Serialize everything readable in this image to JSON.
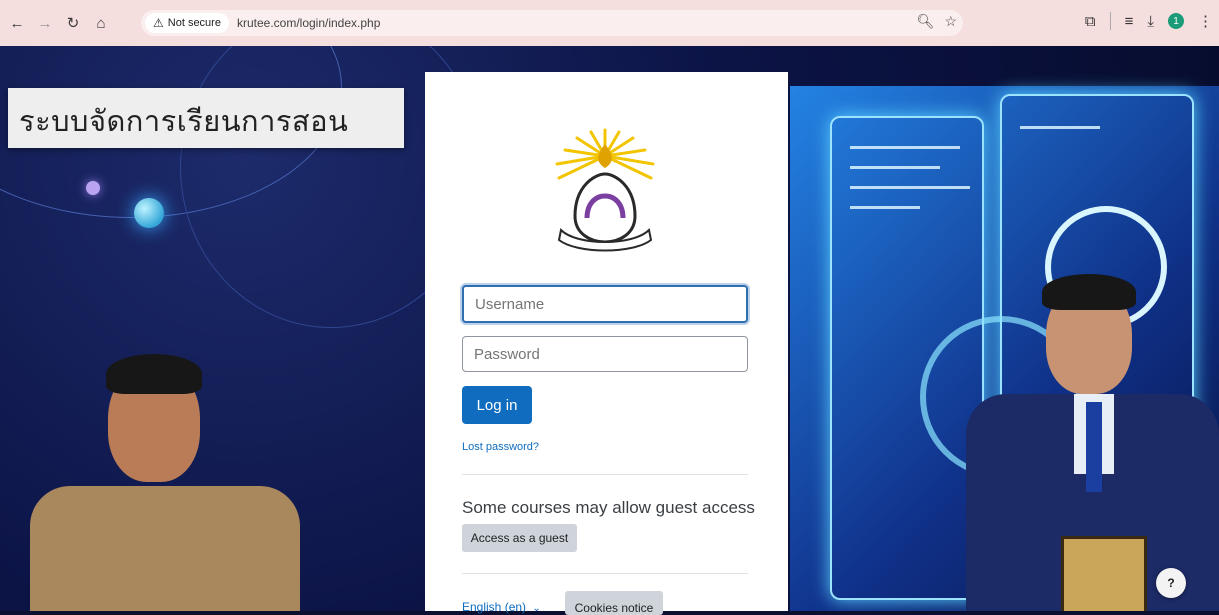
{
  "browser": {
    "security_label": "Not secure",
    "url": "krutee.com/login/index.php",
    "profile_initial": "1"
  },
  "banner": {
    "title": "ระบบจัดการเรียนการสอน"
  },
  "login": {
    "username_placeholder": "Username",
    "password_placeholder": "Password",
    "login_button": "Log in",
    "lost_password": "Lost password?",
    "guest_heading": "Some courses may allow guest access",
    "guest_button": "Access as a guest",
    "language": "English ‎(en)‎",
    "cookies_button": "Cookies notice"
  },
  "help_button": "?",
  "colors": {
    "toolbar_bg": "#f5dede",
    "primary": "#0f6cbf",
    "secondary_button": "#ced4da"
  }
}
